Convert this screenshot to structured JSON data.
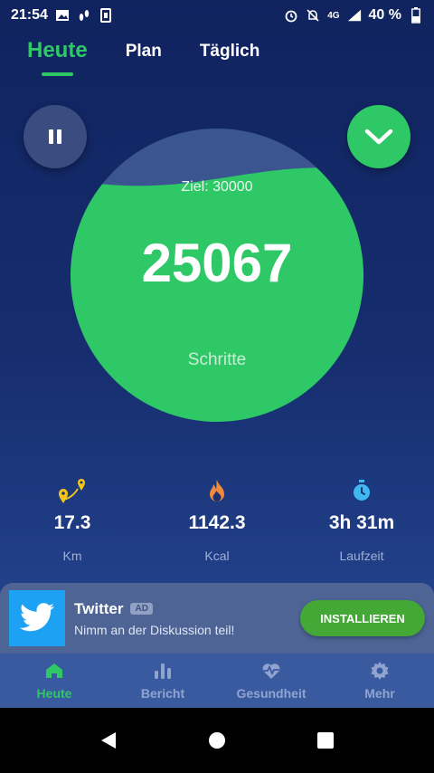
{
  "status_bar": {
    "time": "21:54",
    "network": "4G",
    "battery": "40 %"
  },
  "tabs": [
    {
      "label": "Heute",
      "active": true
    },
    {
      "label": "Plan",
      "active": false
    },
    {
      "label": "Täglich",
      "active": false
    }
  ],
  "gauge": {
    "goal_label": "Ziel: 30000",
    "value": "25067",
    "unit": "Schritte",
    "progress": 0.8356,
    "color": "#2ec866"
  },
  "stats": [
    {
      "icon": "route-pin-icon",
      "value": "17.3",
      "label": "Km"
    },
    {
      "icon": "flame-icon",
      "value": "1142.3",
      "label": "Kcal"
    },
    {
      "icon": "stopwatch-icon",
      "value": "3h 31m",
      "label": "Laufzeit"
    }
  ],
  "ad": {
    "title": "Twitter",
    "badge": "AD",
    "subtitle": "Nimm an der Diskussion teil!",
    "button": "INSTALLIEREN"
  },
  "bottom_nav": [
    {
      "label": "Heute",
      "icon": "home-icon",
      "active": true
    },
    {
      "label": "Bericht",
      "icon": "bar-chart-icon",
      "active": false
    },
    {
      "label": "Gesundheit",
      "icon": "heart-pulse-icon",
      "active": false
    },
    {
      "label": "Mehr",
      "icon": "gear-icon",
      "active": false
    }
  ],
  "colors": {
    "accent": "#2ec866",
    "background_top": "#10235f",
    "background_bottom": "#2a4f9e"
  }
}
